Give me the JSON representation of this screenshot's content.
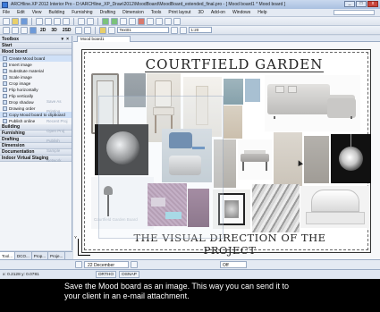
{
  "window": {
    "title": "ARCHline.XP 2012 Interior Pro - D:\\ARCHline_XP_Draw\\2012\\MoodBoard\\MoodBoard_extended_final.pro - [ Mood board1 * Mood board ]",
    "controls": {
      "minimize": "_",
      "maximize": "□",
      "close": "x"
    }
  },
  "menu": {
    "items": [
      "File",
      "Edit",
      "View",
      "Building",
      "Furnishing",
      "Drafting",
      "Dimension",
      "Tools",
      "Print layout",
      "3D",
      "Add-on",
      "Windows",
      "Help"
    ]
  },
  "toolbar": {
    "view_buttons": [
      "2D",
      "3D",
      "2SD"
    ],
    "layer_combo": "Text01",
    "scale_label": "1:20"
  },
  "toolbox": {
    "title": "Toolbox",
    "sections": {
      "start": "Start",
      "mood_board": "Mood board",
      "building": "Building",
      "furnishing": "Furnishing",
      "drafting": "Drafting",
      "dimension": "Dimension",
      "documentation": "Documentation",
      "indoor": "Indoor Virtual Staging"
    },
    "mood_items": [
      "Create Mood board",
      "Insert image",
      "Substitute material",
      "Scale image",
      "Crop image",
      "Flip horizontally",
      "Flip vertically",
      "Drop shadow",
      "Drawing order",
      "Copy Mood board to clipboard",
      "Publish online"
    ],
    "ghost_items": [
      "Save As",
      "Printing",
      "Recent Proj",
      "Open Proj",
      "Publish",
      "Sample",
      "Network"
    ],
    "bottom_tabs": [
      "Tool...",
      "DCO...",
      "Prop...",
      "Proje..."
    ]
  },
  "document": {
    "tab_label": "Mood board1",
    "board_title": "COURTFIELD GARDEN",
    "board_footer": "THE VISUAL DIRECTION OF THE PROJECT",
    "ghost_text": "Courtfield Garden Board",
    "axes_y": "Y",
    "axes_x": "X"
  },
  "status": {
    "date": "22 December",
    "off_value": "Off",
    "coordinates": "x: 0.2128  y: 0.0781",
    "modes": [
      "ORTHO",
      "OSNAP"
    ]
  },
  "caption": {
    "line1": "Save the Mood board as an image. This way you can send it to",
    "line2": "your client in an e-mail attachment."
  }
}
